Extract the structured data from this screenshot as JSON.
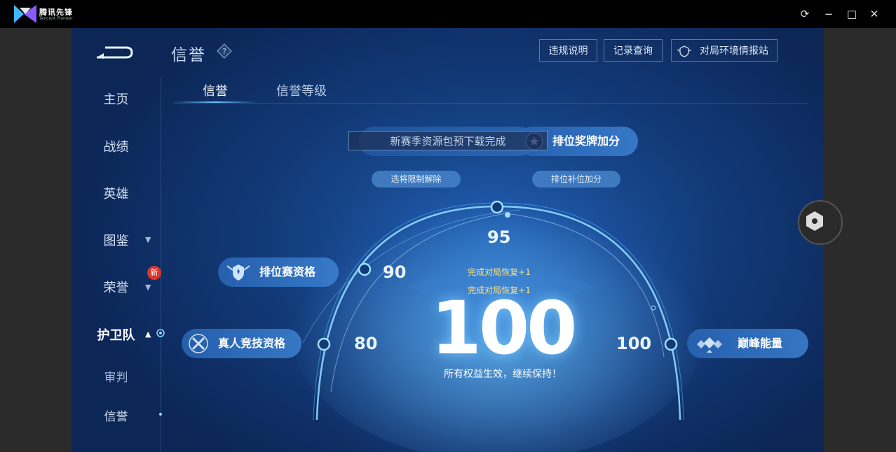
{
  "app": {
    "name": "腾讯先锋",
    "sub": "Tencent Pioneer",
    "brand_color": "#3fb8ff"
  },
  "window_controls": {
    "refresh": "⟳",
    "minimize": "−",
    "maximize": "□",
    "close": "✕"
  },
  "header": {
    "title": "信誉",
    "buttons": [
      "违规说明",
      "记录查询",
      "对局环境情报站"
    ]
  },
  "sidebar": {
    "items": [
      {
        "label": "主页"
      },
      {
        "label": "战绩"
      },
      {
        "label": "英雄"
      },
      {
        "label": "图鉴"
      },
      {
        "label": "荣誉",
        "badge": "新"
      },
      {
        "label": "护卫队"
      },
      {
        "label": "审判"
      },
      {
        "label": "信誉"
      }
    ]
  },
  "tabs": [
    "信誉",
    "信誉等级"
  ],
  "toast": "新赛季资源包预下载完成",
  "benefits": {
    "rank_medal": "排位奖牌加分",
    "select_limit": "选将限制解除",
    "rank_fill": "排位补位加分",
    "ranked": "排位赛资格",
    "pvp": "真人竞技资格",
    "peak": "巅峰能量"
  },
  "thresholds": {
    "t80": "80",
    "t90": "90",
    "t95": "95",
    "t100": "100"
  },
  "score": {
    "value": "100",
    "recover1": "完成对局恢复+1",
    "recover2": "完成对局恢复+1",
    "status": "所有权益生效，继续保持！"
  }
}
